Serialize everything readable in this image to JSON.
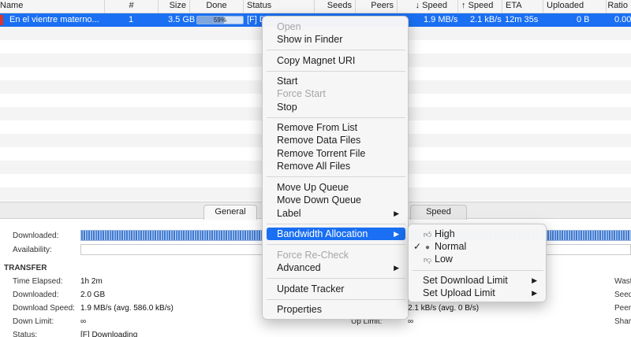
{
  "table": {
    "columns": [
      "Name",
      "#",
      "Size",
      "Done",
      "Status",
      "Seeds",
      "Peers",
      "↓ Speed",
      "↑ Speed",
      "ETA",
      "Uploaded",
      "Ratio"
    ],
    "selected_row": {
      "name": "En el vientre materno...",
      "queue": "1",
      "size": "3.5 GB",
      "done_percent": 59,
      "done_label": "59%",
      "status": "[F] D",
      "down_speed": "1.9 MB/s",
      "up_speed": "2.1 kB/s",
      "eta": "12m 35s",
      "uploaded": "0 B",
      "ratio": "0.00"
    }
  },
  "tabs": {
    "general": "General",
    "speed": "Speed"
  },
  "info": {
    "downloaded_label": "Downloaded:",
    "availability_label": "Availability:",
    "transfer_section": "TRANSFER",
    "time_elapsed_label": "Time Elapsed:",
    "time_elapsed_value": "1h 2m",
    "downloaded2_label": "Downloaded:",
    "downloaded2_value": "2.0 GB",
    "download_speed_label": "Download Speed:",
    "download_speed_value": "1.9 MB/s (avg. 586.0 kB/s)",
    "down_limit_label": "Down Limit:",
    "down_limit_value": "∞",
    "status_label": "Status:",
    "status_value": "[F] Downloading",
    "upload_speed_value": "2.1 kB/s (avg. 0 B/s)",
    "up_limit_label": "Up Limit:",
    "up_limit_value": "∞",
    "right_wasted": "Wast",
    "right_seeds": "Seed",
    "right_peers": "Peer",
    "right_share": "Shar"
  },
  "context_menu": {
    "open": "Open",
    "show_in_finder": "Show in Finder",
    "copy_magnet": "Copy Magnet URI",
    "start": "Start",
    "force_start": "Force Start",
    "stop": "Stop",
    "remove_from_list": "Remove From List",
    "remove_data_files": "Remove Data Files",
    "remove_torrent_file": "Remove Torrent File",
    "remove_all_files": "Remove All Files",
    "move_up_queue": "Move Up Queue",
    "move_down_queue": "Move Down Queue",
    "label": "Label",
    "bandwidth_allocation": "Bandwidth Allocation",
    "force_recheck": "Force Re-Check",
    "advanced": "Advanced",
    "update_tracker": "Update Tracker",
    "properties": "Properties"
  },
  "bandwidth_submenu": {
    "high": "High",
    "normal": "Normal",
    "low": "Low",
    "selected": "Normal",
    "set_download_limit": "Set Download Limit",
    "set_upload_limit": "Set Upload Limit"
  },
  "colors": {
    "selection": "#1a6ff2",
    "progress_fill": "#7fa6dd"
  }
}
